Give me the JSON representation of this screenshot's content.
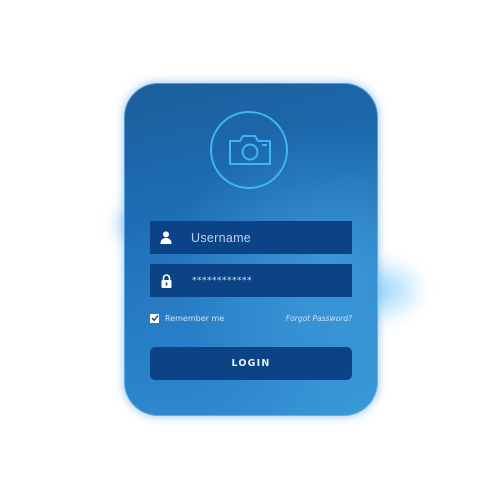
{
  "avatar": {
    "icon": "camera-icon"
  },
  "username": {
    "icon": "user-icon",
    "placeholder": "Username"
  },
  "password": {
    "icon": "lock-icon",
    "masked_value": "************"
  },
  "remember": {
    "label": "Remember me",
    "checked": true
  },
  "forgot": {
    "label": "Forgot Password?"
  },
  "login": {
    "label": "LOGIN"
  },
  "colors": {
    "field_bg": "#0c4386",
    "ring": "#3fb6f5",
    "card_top": "#1c5f9c",
    "card_bottom": "#3a9ad8"
  }
}
